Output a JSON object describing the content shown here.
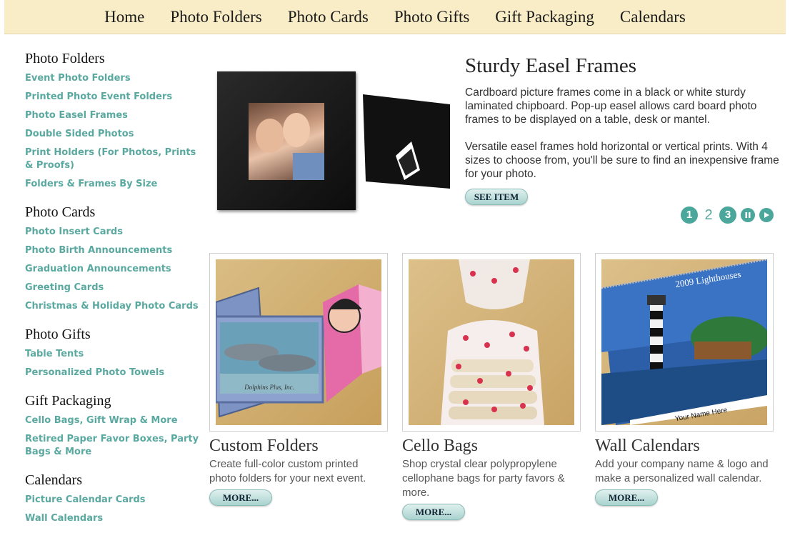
{
  "nav": [
    "Home",
    "Photo Folders",
    "Photo Cards",
    "Photo Gifts",
    "Gift Packaging",
    "Calendars"
  ],
  "sidebar": {
    "sections": [
      {
        "heading": "Photo Folders",
        "links": [
          "Event Photo Folders",
          "Printed Photo Event Folders",
          "Photo Easel Frames",
          "Double Sided Photos",
          "Print Holders (For Photos, Prints & Proofs)",
          "Folders & Frames By Size"
        ]
      },
      {
        "heading": "Photo Cards",
        "links": [
          "Photo Insert Cards",
          "Photo Birth Announcements",
          "Graduation Announcements",
          "Greeting Cards",
          "Christmas & Holiday Photo Cards"
        ]
      },
      {
        "heading": "Photo Gifts",
        "links": [
          "Table Tents",
          "Personalized Photo Towels"
        ]
      },
      {
        "heading": "Gift Packaging",
        "links": [
          "Cello Bags, Gift Wrap & More",
          "Retired Paper Favor Boxes, Party Bags & More"
        ]
      },
      {
        "heading": "Calendars",
        "links": [
          "Picture Calendar Cards",
          "Wall Calendars"
        ]
      }
    ]
  },
  "hero": {
    "title": "Sturdy Easel Frames",
    "paragraph1": "Cardboard picture frames come in a black or white sturdy laminated chipboard. Pop-up easel allows card board photo frames to be displayed on a table, desk or mantel.",
    "paragraph2": "Versatile easel frames hold horizontal or vertical prints. With 4 sizes to choose from, you'll be sure to find an inexpensive frame for your photo.",
    "button": "SEE ITEM"
  },
  "pager": {
    "pages": [
      "1",
      "2",
      "3"
    ]
  },
  "cards": [
    {
      "title": "Custom Folders",
      "desc": "Create full-color custom printed photo folders for your next event.",
      "button": "MORE...",
      "image_text": "Dolphins Plus, Inc."
    },
    {
      "title": "Cello Bags",
      "desc": "Shop crystal clear polypropylene cellophane bags for party favors & more.",
      "button": "MORE..."
    },
    {
      "title": "Wall Calendars",
      "desc": "Add your company name & logo and make a personalized wall calendar.",
      "button": "MORE...",
      "image_text": "2009 Lighthouses",
      "image_text2": "Your Name Here"
    }
  ],
  "colors": {
    "nav_bg": "#f8edc6",
    "link": "#5aa9a0",
    "accent": "#4ba69b"
  }
}
